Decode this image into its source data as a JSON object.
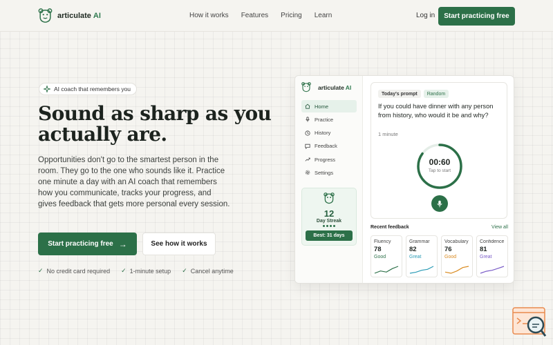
{
  "nav": {
    "brand": "articulate",
    "brand_ai": "AI",
    "links": [
      "How it works",
      "Features",
      "Pricing",
      "Learn"
    ],
    "login": "Log in",
    "cta": "Start practicing free"
  },
  "hero": {
    "badge": "AI coach that remembers you",
    "headline": "Sound as sharp as you actually are.",
    "subtext": "Opportunities don't go to the smartest person in the room. They go to the one who sounds like it. Practice one minute a day with an AI coach that remembers how you communicate, tracks your progress, and gives feedback that gets more personal every session.",
    "primary_button": "Start practicing free",
    "secondary_button": "See how it works",
    "checks": [
      "No credit card required",
      "1-minute setup",
      "Cancel anytime"
    ]
  },
  "app": {
    "brand": "articulate",
    "brand_ai": "AI",
    "menu": [
      {
        "label": "Home",
        "icon": "home-icon"
      },
      {
        "label": "Practice",
        "icon": "mic-icon"
      },
      {
        "label": "History",
        "icon": "clock-icon"
      },
      {
        "label": "Feedback",
        "icon": "chat-icon"
      },
      {
        "label": "Progress",
        "icon": "trend-icon"
      },
      {
        "label": "Settings",
        "icon": "gear-icon"
      }
    ],
    "streak": {
      "count": "12",
      "label": "Day Streak",
      "best": "Best: 31 days"
    },
    "prompt": {
      "tag": "Today's prompt",
      "mode": "Random",
      "question": "If you could have dinner with any person from history, who would it be and why?",
      "duration": "1 minute",
      "timer": "00:60",
      "timer_hint": "Tap to start",
      "timer_progress": 0.85
    },
    "feedback": {
      "title": "Recent feedback",
      "view_all": "View all",
      "metrics": [
        {
          "name": "Fluency",
          "value": "78",
          "rating": "Good",
          "color": "#2c7048",
          "trend": [
            2,
            4,
            3,
            6,
            8
          ]
        },
        {
          "name": "Grammar",
          "value": "82",
          "rating": "Great",
          "color": "#2a9bb5",
          "trend": [
            2,
            3,
            5,
            6,
            9
          ]
        },
        {
          "name": "Vocabulary",
          "value": "76",
          "rating": "Good",
          "color": "#d98a1e",
          "trend": [
            3,
            2,
            4,
            7,
            8
          ]
        },
        {
          "name": "Confidence",
          "value": "81",
          "rating": "Great",
          "color": "#7a5cc7",
          "trend": [
            2,
            4,
            5,
            7,
            9
          ]
        }
      ]
    }
  },
  "colors": {
    "accent": "#2c7048",
    "background": "#f5f4f0"
  }
}
